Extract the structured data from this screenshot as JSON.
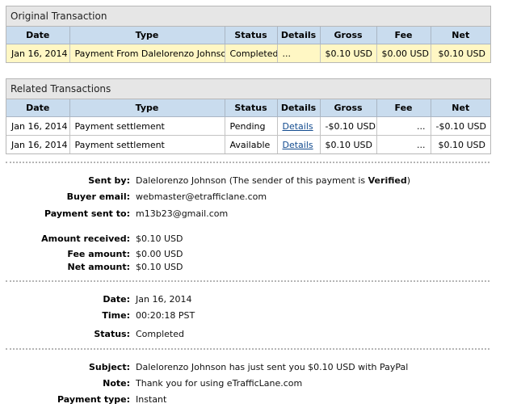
{
  "original": {
    "title": "Original Transaction",
    "headers": [
      "Date",
      "Type",
      "Status",
      "Details",
      "Gross",
      "Fee",
      "Net"
    ],
    "row": {
      "date": "Jan 16, 2014",
      "type": "Payment From Dalelorenzo Johnson",
      "status": "Completed",
      "details": "...",
      "gross": "$0.10 USD",
      "fee": "$0.00 USD",
      "net": "$0.10 USD"
    }
  },
  "related": {
    "title": "Related Transactions",
    "headers": [
      "Date",
      "Type",
      "Status",
      "Details",
      "Gross",
      "Fee",
      "Net"
    ],
    "rows": [
      {
        "date": "Jan 16, 2014",
        "type": "Payment settlement",
        "status": "Pending",
        "details": "Details",
        "gross": "-$0.10 USD",
        "fee": "...",
        "net": "-$0.10 USD"
      },
      {
        "date": "Jan 16, 2014",
        "type": "Payment settlement",
        "status": "Available",
        "details": "Details",
        "gross": "$0.10 USD",
        "fee": "...",
        "net": "$0.10 USD"
      }
    ]
  },
  "details": {
    "sent_by_label": "Sent by:",
    "sent_by_name": "Dalelorenzo Johnson",
    "sent_by_note_prefix": " (The sender of this payment is ",
    "sent_by_status": "Verified",
    "sent_by_note_suffix": ")",
    "buyer_email_label": "Buyer email:",
    "buyer_email": "webmaster@etrafficlane.com",
    "sent_to_label": "Payment sent to:",
    "sent_to": "m13b23@gmail.com",
    "amount_received_label": "Amount received:",
    "amount_received": "$0.10 USD",
    "fee_amount_label": "Fee amount:",
    "fee_amount": "$0.00 USD",
    "net_amount_label": "Net amount:",
    "net_amount": "$0.10 USD",
    "date_label": "Date:",
    "date": "Jan 16, 2014",
    "time_label": "Time:",
    "time": "00:20:18 PST",
    "status_label": "Status:",
    "status": "Completed",
    "subject_label": "Subject:",
    "subject": "Dalelorenzo Johnson has just sent you $0.10 USD with PayPal",
    "note_label": "Note:",
    "note": "Thank you for using eTrafficLane.com",
    "payment_type_label": "Payment type:",
    "payment_type": "Instant"
  }
}
